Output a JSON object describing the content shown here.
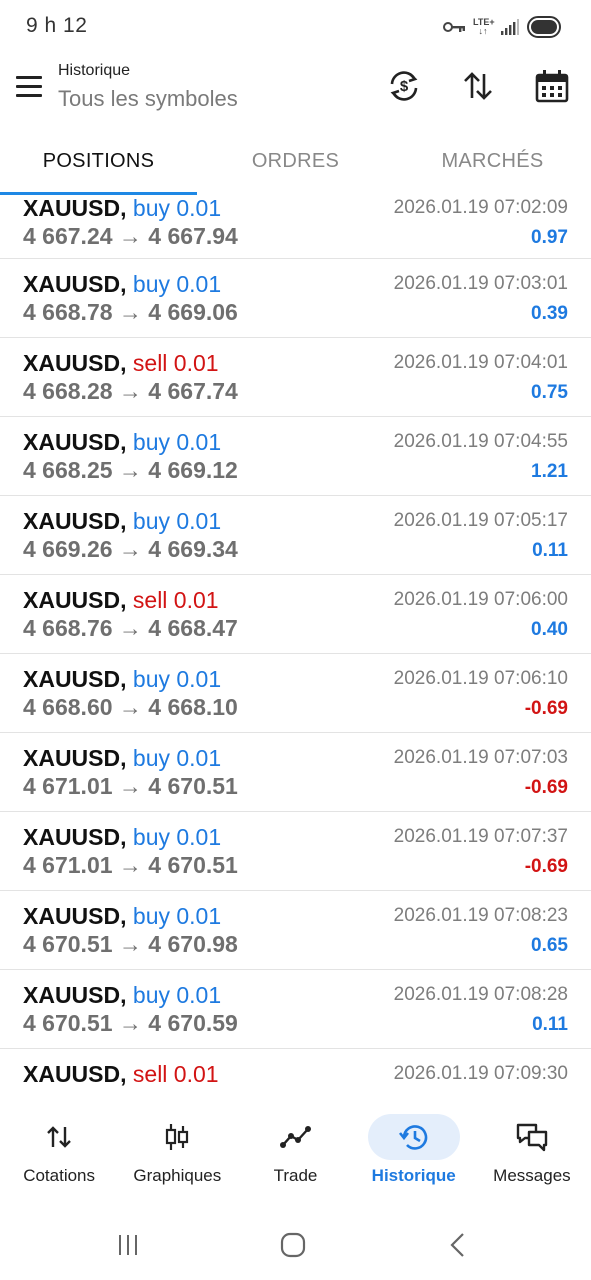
{
  "status": {
    "time": "9 h 12",
    "network_top": "LTE+",
    "network_bottom": "↓↑"
  },
  "header": {
    "title": "Historique",
    "subtitle": "Tous les symboles",
    "icons": [
      "currency-exchange-icon",
      "sort-icon",
      "calendar-icon"
    ]
  },
  "tabs": [
    {
      "label": "POSITIONS",
      "active": true
    },
    {
      "label": "ORDRES",
      "active": false
    },
    {
      "label": "MARCHÉS",
      "active": false
    }
  ],
  "colors": {
    "accent": "#1e7ae0",
    "buy": "#1e7ae0",
    "sell": "#d21414",
    "loss": "#d21414"
  },
  "trades": [
    {
      "symbol": "XAUUSD,",
      "side": "buy",
      "side_label": "buy 0.01",
      "prices": "4 667.24 → 4 667.94",
      "time": "2026.01.19 07:02:09",
      "profit": "0.97"
    },
    {
      "symbol": "XAUUSD,",
      "side": "buy",
      "side_label": "buy 0.01",
      "prices": "4 668.78 → 4 669.06",
      "time": "2026.01.19 07:03:01",
      "profit": "0.39"
    },
    {
      "symbol": "XAUUSD,",
      "side": "sell",
      "side_label": "sell 0.01",
      "prices": "4 668.28 → 4 667.74",
      "time": "2026.01.19 07:04:01",
      "profit": "0.75"
    },
    {
      "symbol": "XAUUSD,",
      "side": "buy",
      "side_label": "buy 0.01",
      "prices": "4 668.25 → 4 669.12",
      "time": "2026.01.19 07:04:55",
      "profit": "1.21"
    },
    {
      "symbol": "XAUUSD,",
      "side": "buy",
      "side_label": "buy 0.01",
      "prices": "4 669.26 → 4 669.34",
      "time": "2026.01.19 07:05:17",
      "profit": "0.11"
    },
    {
      "symbol": "XAUUSD,",
      "side": "sell",
      "side_label": "sell 0.01",
      "prices": "4 668.76 → 4 668.47",
      "time": "2026.01.19 07:06:00",
      "profit": "0.40"
    },
    {
      "symbol": "XAUUSD,",
      "side": "buy",
      "side_label": "buy 0.01",
      "prices": "4 668.60 → 4 668.10",
      "time": "2026.01.19 07:06:10",
      "profit": "-0.69"
    },
    {
      "symbol": "XAUUSD,",
      "side": "buy",
      "side_label": "buy 0.01",
      "prices": "4 671.01 → 4 670.51",
      "time": "2026.01.19 07:07:03",
      "profit": "-0.69"
    },
    {
      "symbol": "XAUUSD,",
      "side": "buy",
      "side_label": "buy 0.01",
      "prices": "4 671.01 → 4 670.51",
      "time": "2026.01.19 07:07:37",
      "profit": "-0.69"
    },
    {
      "symbol": "XAUUSD,",
      "side": "buy",
      "side_label": "buy 0.01",
      "prices": "4 670.51 → 4 670.98",
      "time": "2026.01.19 07:08:23",
      "profit": "0.65"
    },
    {
      "symbol": "XAUUSD,",
      "side": "buy",
      "side_label": "buy 0.01",
      "prices": "4 670.51 → 4 670.59",
      "time": "2026.01.19 07:08:28",
      "profit": "0.11"
    },
    {
      "symbol": "XAUUSD,",
      "side": "sell",
      "side_label": "sell 0.01",
      "prices": "",
      "time": "2026.01.19 07:09:30",
      "profit": ""
    }
  ],
  "bottom_nav": [
    {
      "label": "Cotations",
      "icon": "quotes-icon",
      "active": false
    },
    {
      "label": "Graphiques",
      "icon": "candlestick-icon",
      "active": false
    },
    {
      "label": "Trade",
      "icon": "trade-line-icon",
      "active": false
    },
    {
      "label": "Historique",
      "icon": "history-icon",
      "active": true
    },
    {
      "label": "Messages",
      "icon": "messages-icon",
      "active": false
    }
  ]
}
